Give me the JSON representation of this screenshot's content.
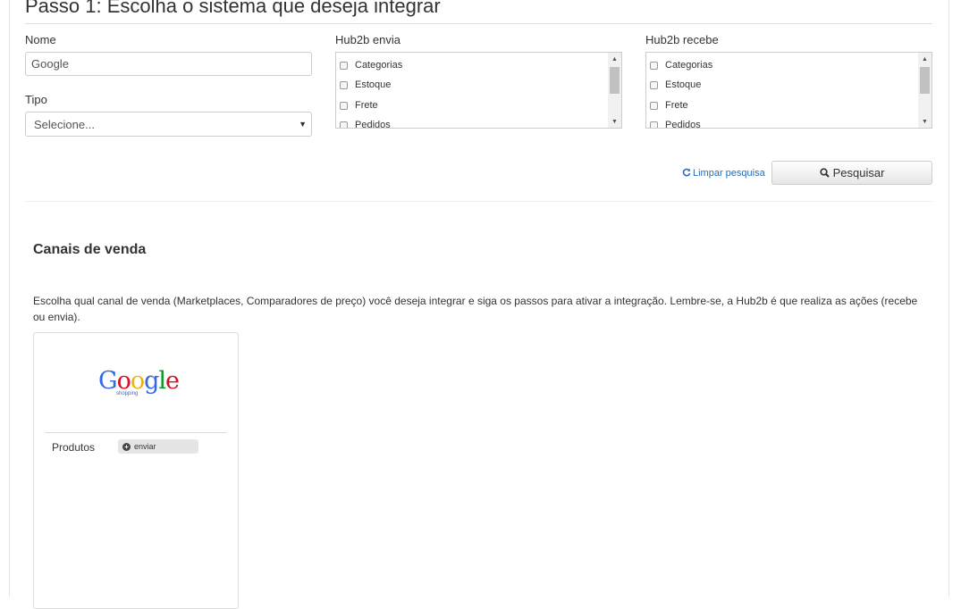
{
  "page": {
    "title": "Passo 1: Escolha o sistema que deseja integrar"
  },
  "form": {
    "nome": {
      "label": "Nome",
      "value": "Google"
    },
    "tipo": {
      "label": "Tipo",
      "selected": "Selecione..."
    },
    "envia": {
      "label": "Hub2b envia",
      "options": [
        "Categorias",
        "Estoque",
        "Frete",
        "Pedidos"
      ]
    },
    "recebe": {
      "label": "Hub2b recebe",
      "options": [
        "Categorias",
        "Estoque",
        "Frete",
        "Pedidos"
      ]
    },
    "clear_label": "Limpar pesquisa",
    "search_label": "Pesquisar"
  },
  "channels": {
    "title": "Canais de venda",
    "description": "Escolha qual canal de venda (Marketplaces, Comparadores de preço) você deseja integrar e siga os passos para ativar a integração. Lembre-se, a Hub2b é que realiza as ações (recebe ou envia).",
    "cards": [
      {
        "logo_text": "Google",
        "logo_sub": "shopping",
        "row_label": "Produtos",
        "action_label": "enviar"
      }
    ]
  },
  "colors": {
    "link": "#2a6bb0",
    "border": "#cccccc"
  }
}
